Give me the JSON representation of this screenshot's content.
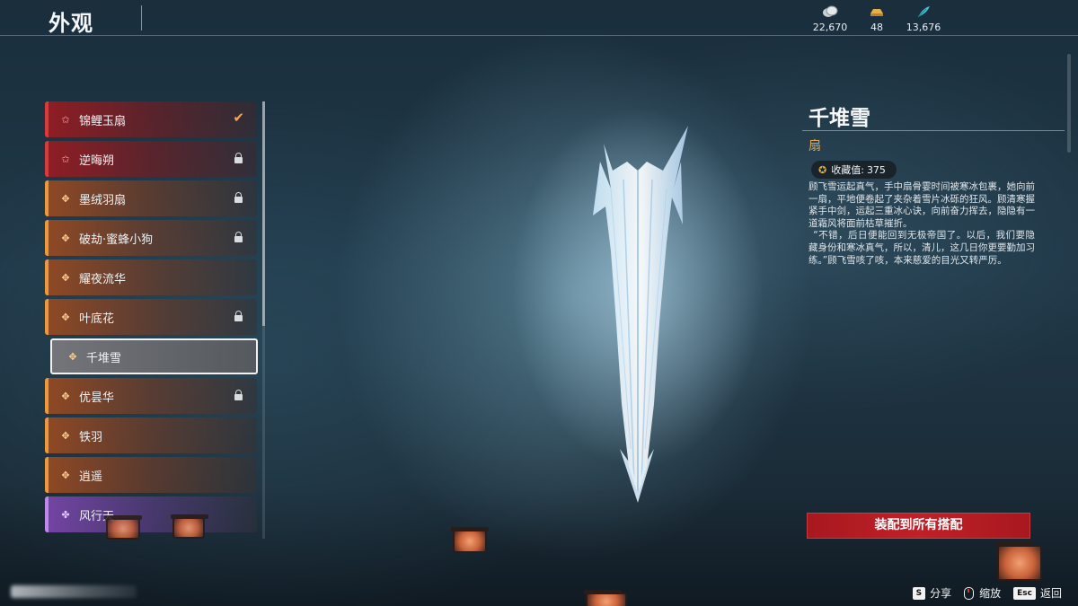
{
  "header": {
    "title": "外观"
  },
  "currencies": [
    {
      "icon": "silver-coin-icon",
      "value": "22,670",
      "color": "#c9d1d6"
    },
    {
      "icon": "gold-ingot-icon",
      "value": "48",
      "color": "#e3b04b"
    },
    {
      "icon": "jade-feather-icon",
      "value": "13,676",
      "color": "#3fc8d8"
    }
  ],
  "list": {
    "items": [
      {
        "label": "锦鲤玉扇",
        "rarity": "red",
        "state": "equipped"
      },
      {
        "label": "逆晦朔",
        "rarity": "red",
        "state": "locked"
      },
      {
        "label": "墨绒羽扇",
        "rarity": "orange",
        "state": "locked"
      },
      {
        "label": "破劫·蜜蜂小狗",
        "rarity": "orange",
        "state": "locked"
      },
      {
        "label": "耀夜流华",
        "rarity": "orange",
        "state": "none"
      },
      {
        "label": "叶底花",
        "rarity": "orange",
        "state": "locked"
      },
      {
        "label": "千堆雪",
        "rarity": "orange",
        "state": "selected"
      },
      {
        "label": "优昙华",
        "rarity": "orange",
        "state": "locked"
      },
      {
        "label": "铁羽",
        "rarity": "orange",
        "state": "none"
      },
      {
        "label": "逍遥",
        "rarity": "orange",
        "state": "none"
      },
      {
        "label": "风行天",
        "rarity": "purple",
        "state": "none"
      }
    ]
  },
  "detail": {
    "title": "千堆雪",
    "type": "扇",
    "collection_label": "收藏值:",
    "collection_value": "375",
    "description_1": "顾飞雪运起真气，手中扇骨霎时间被寒冰包裹，她向前一扇，平地便卷起了夹杂着雪片冰砾的狂风。顾清寒握紧手中剑，运起三重冰心诀，向前奋力挥去，隐隐有一道霜风将面前枯草摧折。",
    "description_2": "“不错，后日便能回到无极帝国了。以后，我们要隐藏身份和寒冰真气，所以，清儿，这几日你更要勤加习练。”顾飞雪咳了咳，本来慈爱的目光又转严厉。",
    "equip_button": "装配到所有搭配"
  },
  "hints": {
    "share_key": "S",
    "share_label": "分享",
    "zoom_label": "缩放",
    "back_key": "Esc",
    "back_label": "返回"
  },
  "colors": {
    "red_rarity": "#d93a3a",
    "orange_rarity": "#e89a3c",
    "purple_rarity": "#b98ae8",
    "type_text": "#e5a64a",
    "equip_button": "#c02028"
  }
}
